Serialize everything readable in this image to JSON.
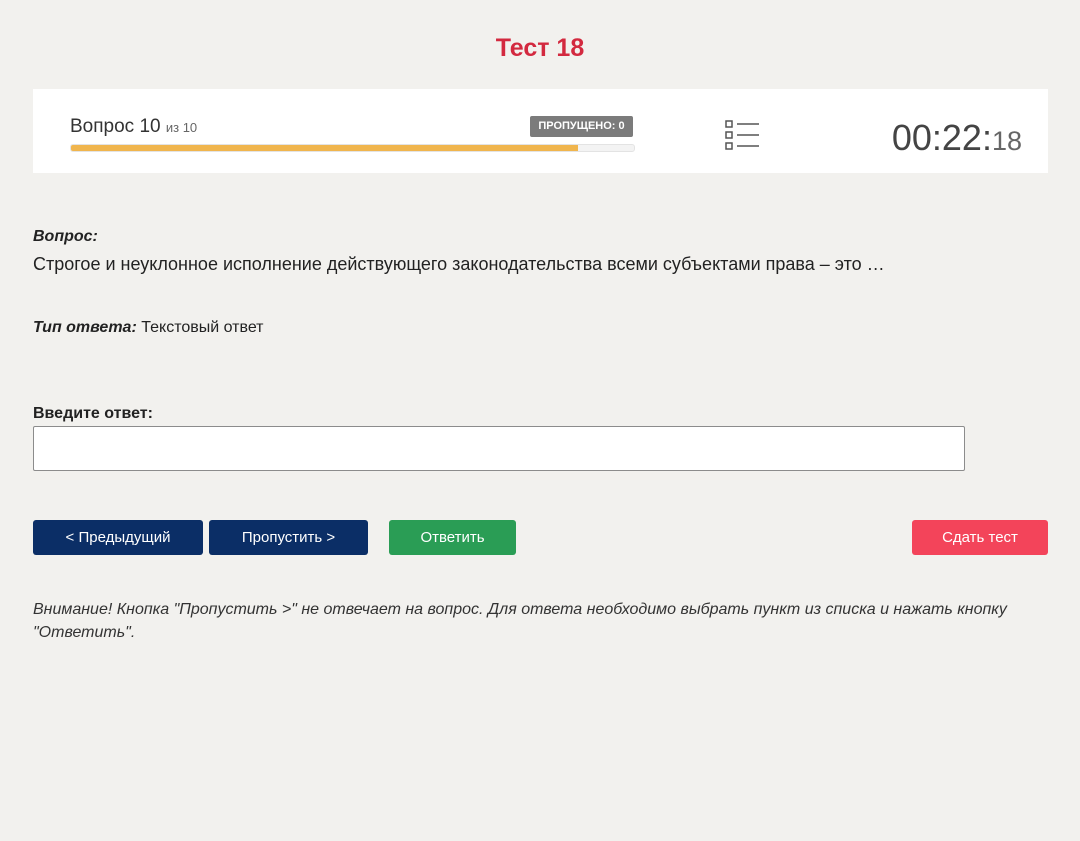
{
  "page": {
    "title": "Тест 18"
  },
  "header": {
    "question_label": "Вопрос 10",
    "question_of": "из 10",
    "skipped_badge": "ПРОПУЩЕНО: 0",
    "progress_fraction": 0.9,
    "list_icon": "list-icon",
    "timer": {
      "main": "00:22:",
      "seconds": "18"
    }
  },
  "question": {
    "heading": "Вопрос:",
    "text": "Строгое и неуклонное исполнение действующего законодательства всеми субъектами права – это …"
  },
  "answer_type": {
    "label": "Тип ответа:",
    "value": "Текстовый ответ"
  },
  "answer": {
    "label": "Введите ответ:",
    "value": "",
    "placeholder": ""
  },
  "buttons": {
    "prev": "< Предыдущий",
    "skip": "Пропустить >",
    "answer": "Ответить",
    "finish": "Сдать тест"
  },
  "notice": "Внимание! Кнопка \"Пропустить >\" не отвечает на вопрос. Для ответа необходимо выбрать пункт из списка и нажать кнопку \"Ответить\".",
  "colors": {
    "title": "#d3293f",
    "progress": "#f0b54d",
    "nav_button": "#0b2e66",
    "answer_button": "#2a9d55",
    "finish_button": "#f3445a",
    "badge": "#7b7b7b",
    "background": "#f2f1ee"
  }
}
